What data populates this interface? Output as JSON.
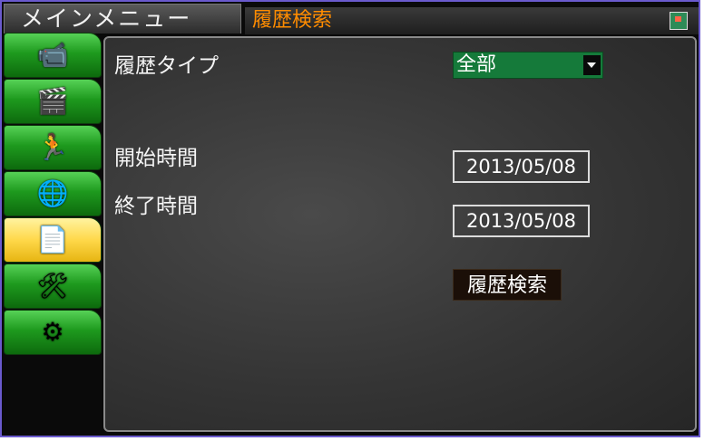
{
  "header": {
    "main_tab": "メインメニュー",
    "sub_tab": "履歴検索"
  },
  "sidebar": {
    "items": [
      {
        "icon": "camera-icon",
        "glyph": "📹",
        "active": false
      },
      {
        "icon": "film-clapper-icon",
        "glyph": "🎬",
        "active": false
      },
      {
        "icon": "running-man-icon",
        "glyph": "🏃",
        "active": false
      },
      {
        "icon": "network-globe-icon",
        "glyph": "🌐",
        "active": false
      },
      {
        "icon": "document-search-icon",
        "glyph": "📄",
        "active": true
      },
      {
        "icon": "system-tools-icon",
        "glyph": "🛠",
        "active": false
      },
      {
        "icon": "gears-icon",
        "glyph": "⚙",
        "active": false
      }
    ]
  },
  "form": {
    "record_type_label": "履歴タイプ",
    "record_type_value": "全部",
    "start_time_label": "開始時間",
    "start_time_value": "2013/05/08",
    "end_time_label": "終了時間",
    "end_time_value": "2013/05/08",
    "search_button": "履歴検索"
  },
  "colors": {
    "sub_tab_text": "#ff8c00",
    "select_bg": "#157a3a",
    "sidebar_green": "#1e9a1e",
    "sidebar_active": "#ffd84a"
  }
}
